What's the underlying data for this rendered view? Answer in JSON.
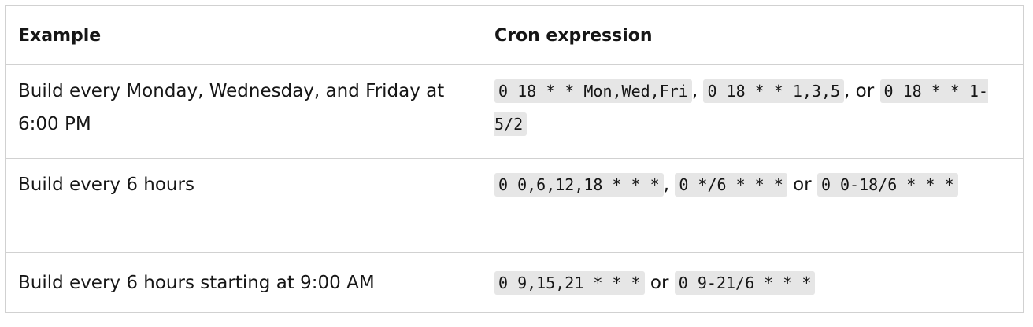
{
  "table": {
    "headers": {
      "example": "Example",
      "cron": "Cron expression"
    },
    "rows": [
      {
        "example": "Build every Monday, Wednesday, and Friday at 6:00 PM",
        "code1": "0 18 * * Mon,Wed,Fri",
        "sep1": ", ",
        "code2": "0 18 * * 1,3,5",
        "sep2": ", or ",
        "code3": "0 18 * * 1-5/2"
      },
      {
        "example": "Build every 6 hours",
        "code1": "0 0,6,12,18 * * *",
        "sep1": ", ",
        "code2": "0 */6 * * *",
        "sep2": " or ",
        "code3": "0 0-18/6 * * *"
      },
      {
        "example": "Build every 6 hours starting at 9:00 AM",
        "code1": "0 9,15,21 * * *",
        "sep1": " or ",
        "code2": "0 9-21/6 * * *"
      }
    ]
  }
}
